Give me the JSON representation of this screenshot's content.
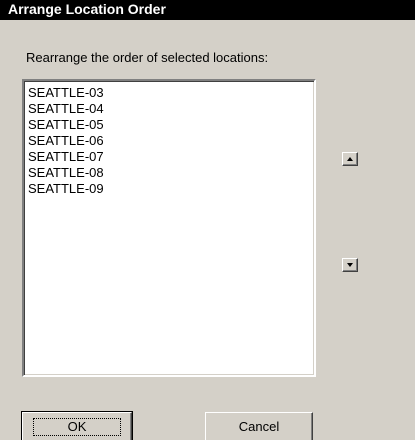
{
  "window": {
    "title": "Arrange Location Order"
  },
  "dialog": {
    "prompt": "Rearrange the order of selected locations:",
    "locations": [
      "SEATTLE-03",
      "SEATTLE-04",
      "SEATTLE-05",
      "SEATTLE-06",
      "SEATTLE-07",
      "SEATTLE-08",
      "SEATTLE-09"
    ],
    "move_up_icon": "triangle-up-icon",
    "move_down_icon": "triangle-down-icon"
  },
  "buttons": {
    "ok_label": "OK",
    "cancel_label": "Cancel"
  },
  "colors": {
    "titlebar": "#000000",
    "dialog_background": "#d4d0c8",
    "list_background": "#ffffff"
  }
}
